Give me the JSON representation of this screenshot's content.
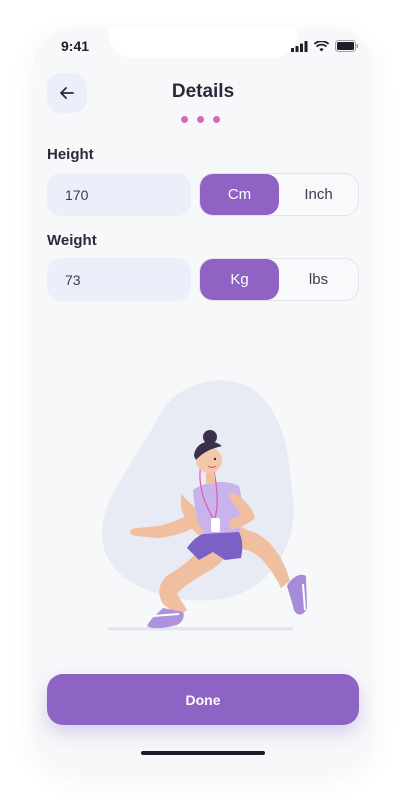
{
  "status_bar": {
    "time": "9:41"
  },
  "header": {
    "title": "Details"
  },
  "height": {
    "label": "Height",
    "value": "170",
    "units": [
      {
        "label": "Cm",
        "selected": true
      },
      {
        "label": "Inch",
        "selected": false
      }
    ]
  },
  "weight": {
    "label": "Weight",
    "value": "73",
    "units": [
      {
        "label": "Kg",
        "selected": true
      },
      {
        "label": "lbs",
        "selected": false
      }
    ]
  },
  "actions": {
    "done_label": "Done"
  },
  "colors": {
    "accent": "#8f62c4",
    "page_dot": "#d768bd",
    "input_bg": "#eceff9",
    "text_dark": "#2a2a3c"
  },
  "icons": {
    "back": "arrow-left-icon",
    "signal": "signal-icon",
    "wifi": "wifi-icon",
    "battery": "battery-icon"
  }
}
